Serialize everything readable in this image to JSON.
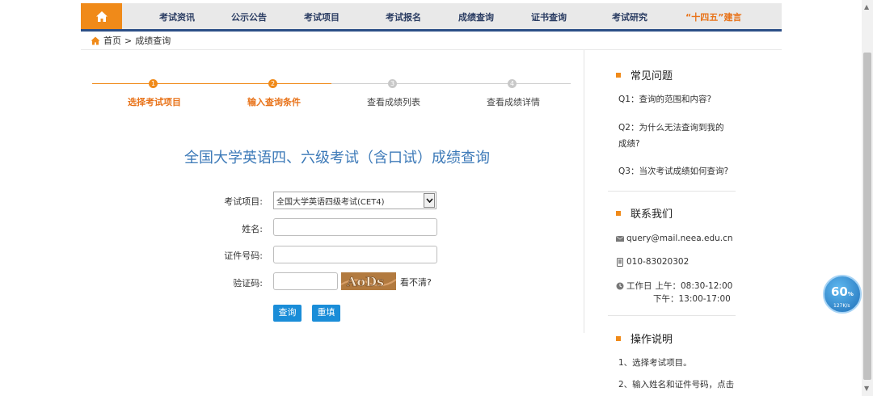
{
  "nav": {
    "items": [
      "考试资讯",
      "公示公告",
      "考试项目",
      "考试报名",
      "成绩查询",
      "证书查询",
      "考试研究",
      "“十四五”建言"
    ]
  },
  "breadcrumb": {
    "home": "首页",
    "separator": ">",
    "current": "成绩查询"
  },
  "steps": [
    {
      "num": "1",
      "label": "选择考试项目",
      "state": "done"
    },
    {
      "num": "2",
      "label": "输入查询条件",
      "state": "done"
    },
    {
      "num": "3",
      "label": "查看成绩列表",
      "state": "todo"
    },
    {
      "num": "4",
      "label": "查看成绩详情",
      "state": "todo"
    }
  ],
  "main": {
    "title": "全国大学英语四、六级考试（含口试）成绩查询",
    "form": {
      "exam_label": "考试项目:",
      "exam_value": "全国大学英语四级考试(CET4)",
      "name_label": "姓名:",
      "name_value": "",
      "id_label": "证件号码:",
      "id_value": "",
      "captcha_label": "验证码:",
      "captcha_value": "",
      "captcha_text": "AoDs",
      "captcha_refresh": "看不清?",
      "query_button": "查询",
      "reset_button": "重填"
    }
  },
  "sidebar": {
    "faq": {
      "title": "常见问题",
      "items": [
        "Q1：查询的范围和内容?",
        "Q2：为什么无法查询到我的成绩?",
        "Q3：当次考试成绩如何查询?"
      ]
    },
    "contact": {
      "title": "联系我们",
      "email": "query@mail.neea.edu.cn",
      "phone": "010-83020302",
      "hours_label": "工作日",
      "hours_am": "上午：08:30-12:00",
      "hours_pm": "下午：13:00-17:00"
    },
    "instructions": {
      "title": "操作说明",
      "items": [
        "1、选择考试项目。",
        "2、输入姓名和证件号码，点击"
      ]
    }
  },
  "widget": {
    "percent": "60",
    "percent_unit": "%",
    "rate": "127K/s"
  },
  "colors": {
    "accent": "#f08a19",
    "nav_text": "#2b3d63",
    "title_blue": "#3d7ab8",
    "button_blue": "#1a8dd8"
  }
}
